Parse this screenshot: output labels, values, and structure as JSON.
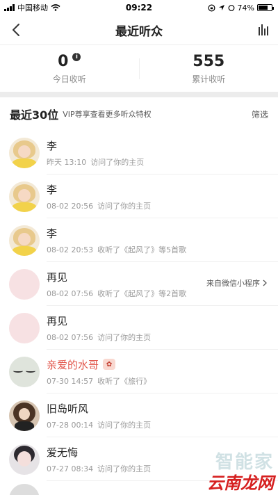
{
  "status_bar": {
    "carrier": "中国移动",
    "time": "09:22",
    "battery": "74%"
  },
  "nav": {
    "title": "最近听众"
  },
  "stats": {
    "today_value": "0",
    "today_label": "今日收听",
    "total_value": "555",
    "total_label": "累计收听"
  },
  "section": {
    "title": "最近30位",
    "subtitle": "VIP尊享查看更多听众特权",
    "filter_label": "筛选"
  },
  "listeners": [
    {
      "name": "李",
      "time": "昨天 13:10",
      "action": "访问了你的主页",
      "source": "",
      "avatar": "girl-avatar"
    },
    {
      "name": "李",
      "time": "08-02 20:56",
      "action": "访问了你的主页",
      "source": "",
      "avatar": "girl-avatar"
    },
    {
      "name": "李",
      "time": "08-02 20:53",
      "action": "收听了《起风了》等5首歌",
      "source": "",
      "avatar": "girl-avatar"
    },
    {
      "name": "再见",
      "time": "08-02 07:56",
      "action": "收听了《起风了》等2首歌",
      "source": "来自微信小程序",
      "avatar": "pink-avatar"
    },
    {
      "name": "再见",
      "time": "08-02 07:56",
      "action": "访问了你的主页",
      "source": "",
      "avatar": "pink-avatar"
    },
    {
      "name": "亲爱的水哥",
      "time": "07-30 14:57",
      "action": "收听了《旅行》",
      "source": "",
      "avatar": "closed-eyes-avatar"
    },
    {
      "name": "旧岛听风",
      "time": "07-28 00:14",
      "action": "访问了你的主页",
      "source": "",
      "avatar": "dark-hair-avatar"
    },
    {
      "name": "爱无悔",
      "time": "07-27 08:34",
      "action": "访问了你的主页",
      "source": "",
      "avatar": "kid-avatar"
    }
  ],
  "watermark": {
    "top": "智能家",
    "bottom": "云南龙网"
  },
  "colors": {
    "accent_name": "#e2574c",
    "page_gap": "#ececec"
  }
}
